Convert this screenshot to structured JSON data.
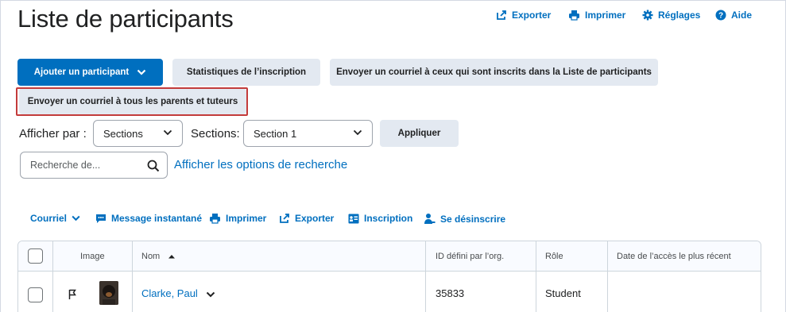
{
  "page": {
    "title": "Liste de participants"
  },
  "top_actions": {
    "export": "Exporter",
    "print": "Imprimer",
    "settings": "Réglages",
    "help": "Aide"
  },
  "buttons": {
    "add_participant": "Ajouter un participant",
    "enrollment_stats": "Statistiques de l’inscription",
    "email_enrolled": "Envoyer un courriel à ceux qui sont inscrits dans la Liste de participants",
    "email_parents": "Envoyer un courriel à tous les parents et tuteurs",
    "apply": "Appliquer"
  },
  "filters": {
    "view_by_label": "Afficher par :",
    "view_by_value": "Sections",
    "sections_label": "Sections:",
    "sections_value": "Section 1"
  },
  "search": {
    "placeholder": "Recherche de...",
    "options_link": "Afficher les options de recherche"
  },
  "toolbar": {
    "email": "Courriel",
    "instant_message": "Message instantané",
    "print": "Imprimer",
    "export": "Exporter",
    "enrollment": "Inscription",
    "unenroll": "Se désinscrire"
  },
  "table": {
    "headers": {
      "image": "Image",
      "name": "Nom",
      "org_id": "ID défini par l’org.",
      "role": "Rôle",
      "last_access": "Date de l’accès le plus récent"
    },
    "rows": [
      {
        "name": "Clarke, Paul",
        "org_id": "35833",
        "role": "Student",
        "last_access": ""
      }
    ]
  },
  "colors": {
    "primary": "#006fbf",
    "secondary_button": "#e3e9f1",
    "highlight": "#c33b3b"
  }
}
